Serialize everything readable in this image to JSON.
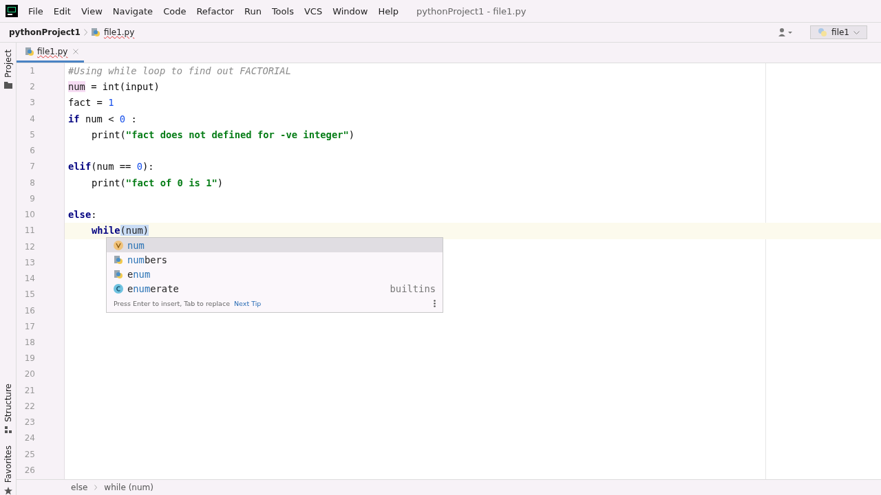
{
  "menu": [
    "File",
    "Edit",
    "View",
    "Navigate",
    "Code",
    "Refactor",
    "Run",
    "Tools",
    "VCS",
    "Window",
    "Help"
  ],
  "window": {
    "title": "pythonProject1 - file1.py"
  },
  "navbar": {
    "project": "pythonProject1",
    "file": "file1.py",
    "run_config": "file1"
  },
  "side_tools": [
    {
      "label": "Project",
      "kind": "folder"
    },
    {
      "label": "Structure",
      "kind": "structure"
    },
    {
      "label": "Favorites",
      "kind": "star"
    }
  ],
  "tabs": [
    {
      "label": "file1.py",
      "selected": true
    }
  ],
  "editor": {
    "lines": [
      {
        "current": false,
        "indent": false,
        "tokens": [
          {
            "text": "#Using while loop to find out FACTORIAL",
            "kind": "comment"
          }
        ]
      },
      {
        "current": false,
        "indent": false,
        "tokens": [
          {
            "text": "num",
            "kind": "mark"
          },
          {
            "text": " = int(input)",
            "kind": "plain"
          }
        ]
      },
      {
        "current": false,
        "indent": false,
        "tokens": [
          {
            "text": "fact = ",
            "kind": "plain"
          },
          {
            "text": "1",
            "kind": "number"
          }
        ]
      },
      {
        "current": false,
        "indent": false,
        "tokens": [
          {
            "text": "if",
            "kind": "keyword"
          },
          {
            "text": " num < ",
            "kind": "plain"
          },
          {
            "text": "0",
            "kind": "number"
          },
          {
            "text": " :",
            "kind": "plain"
          }
        ]
      },
      {
        "current": false,
        "indent": true,
        "tokens": [
          {
            "text": "print(",
            "kind": "plain"
          },
          {
            "text": "\"fact does not defined for -ve integer\"",
            "kind": "string"
          },
          {
            "text": ")",
            "kind": "plain"
          }
        ]
      },
      {
        "current": false
      },
      {
        "current": false,
        "indent": false,
        "tokens": [
          {
            "text": "elif",
            "kind": "keyword"
          },
          {
            "text": "(num == ",
            "kind": "plain"
          },
          {
            "text": "0",
            "kind": "number"
          },
          {
            "text": "):",
            "kind": "plain"
          }
        ]
      },
      {
        "current": false,
        "indent": true,
        "tokens": [
          {
            "text": "print(",
            "kind": "plain"
          },
          {
            "text": "\"fact of 0 is 1\"",
            "kind": "string"
          },
          {
            "text": ")",
            "kind": "plain"
          }
        ]
      },
      {
        "current": false
      },
      {
        "current": false,
        "indent": false,
        "tokens": [
          {
            "text": "else",
            "kind": "keyword"
          },
          {
            "text": ":",
            "kind": "plain"
          }
        ]
      },
      {
        "current": true,
        "indent": true,
        "tokens": [
          {
            "text": "while",
            "kind": "keyword"
          },
          {
            "text": "(num)",
            "kind": "match"
          }
        ]
      },
      {
        "current": false
      },
      {
        "current": false
      },
      {
        "current": false
      },
      {
        "current": false
      },
      {
        "current": false
      },
      {
        "current": false
      },
      {
        "current": false
      },
      {
        "current": false
      },
      {
        "current": false
      },
      {
        "current": false
      },
      {
        "current": false
      },
      {
        "current": false
      },
      {
        "current": false
      },
      {
        "current": false
      },
      {
        "current": false
      }
    ],
    "line_numbers": [
      "1",
      "2",
      "3",
      "4",
      "5",
      "6",
      "7",
      "8",
      "9",
      "10",
      "11",
      "12",
      "13",
      "14",
      "15",
      "16",
      "17",
      "18",
      "19",
      "20",
      "21",
      "22",
      "23",
      "24",
      "25",
      "26"
    ]
  },
  "completion": {
    "items": [
      {
        "kind": "variable",
        "selected": true,
        "label": "**num**"
      },
      {
        "kind": "module",
        "selected": false,
        "label": "**num**bers"
      },
      {
        "kind": "module",
        "selected": false,
        "label": "e**num**"
      },
      {
        "kind": "class",
        "selected": false,
        "label": "e**num**erate",
        "hint": "builtins"
      }
    ],
    "footer": "Press Enter to insert, Tab to replace",
    "tip_link": "Next Tip"
  },
  "breadcrumbs": [
    "else",
    "while (num)"
  ]
}
